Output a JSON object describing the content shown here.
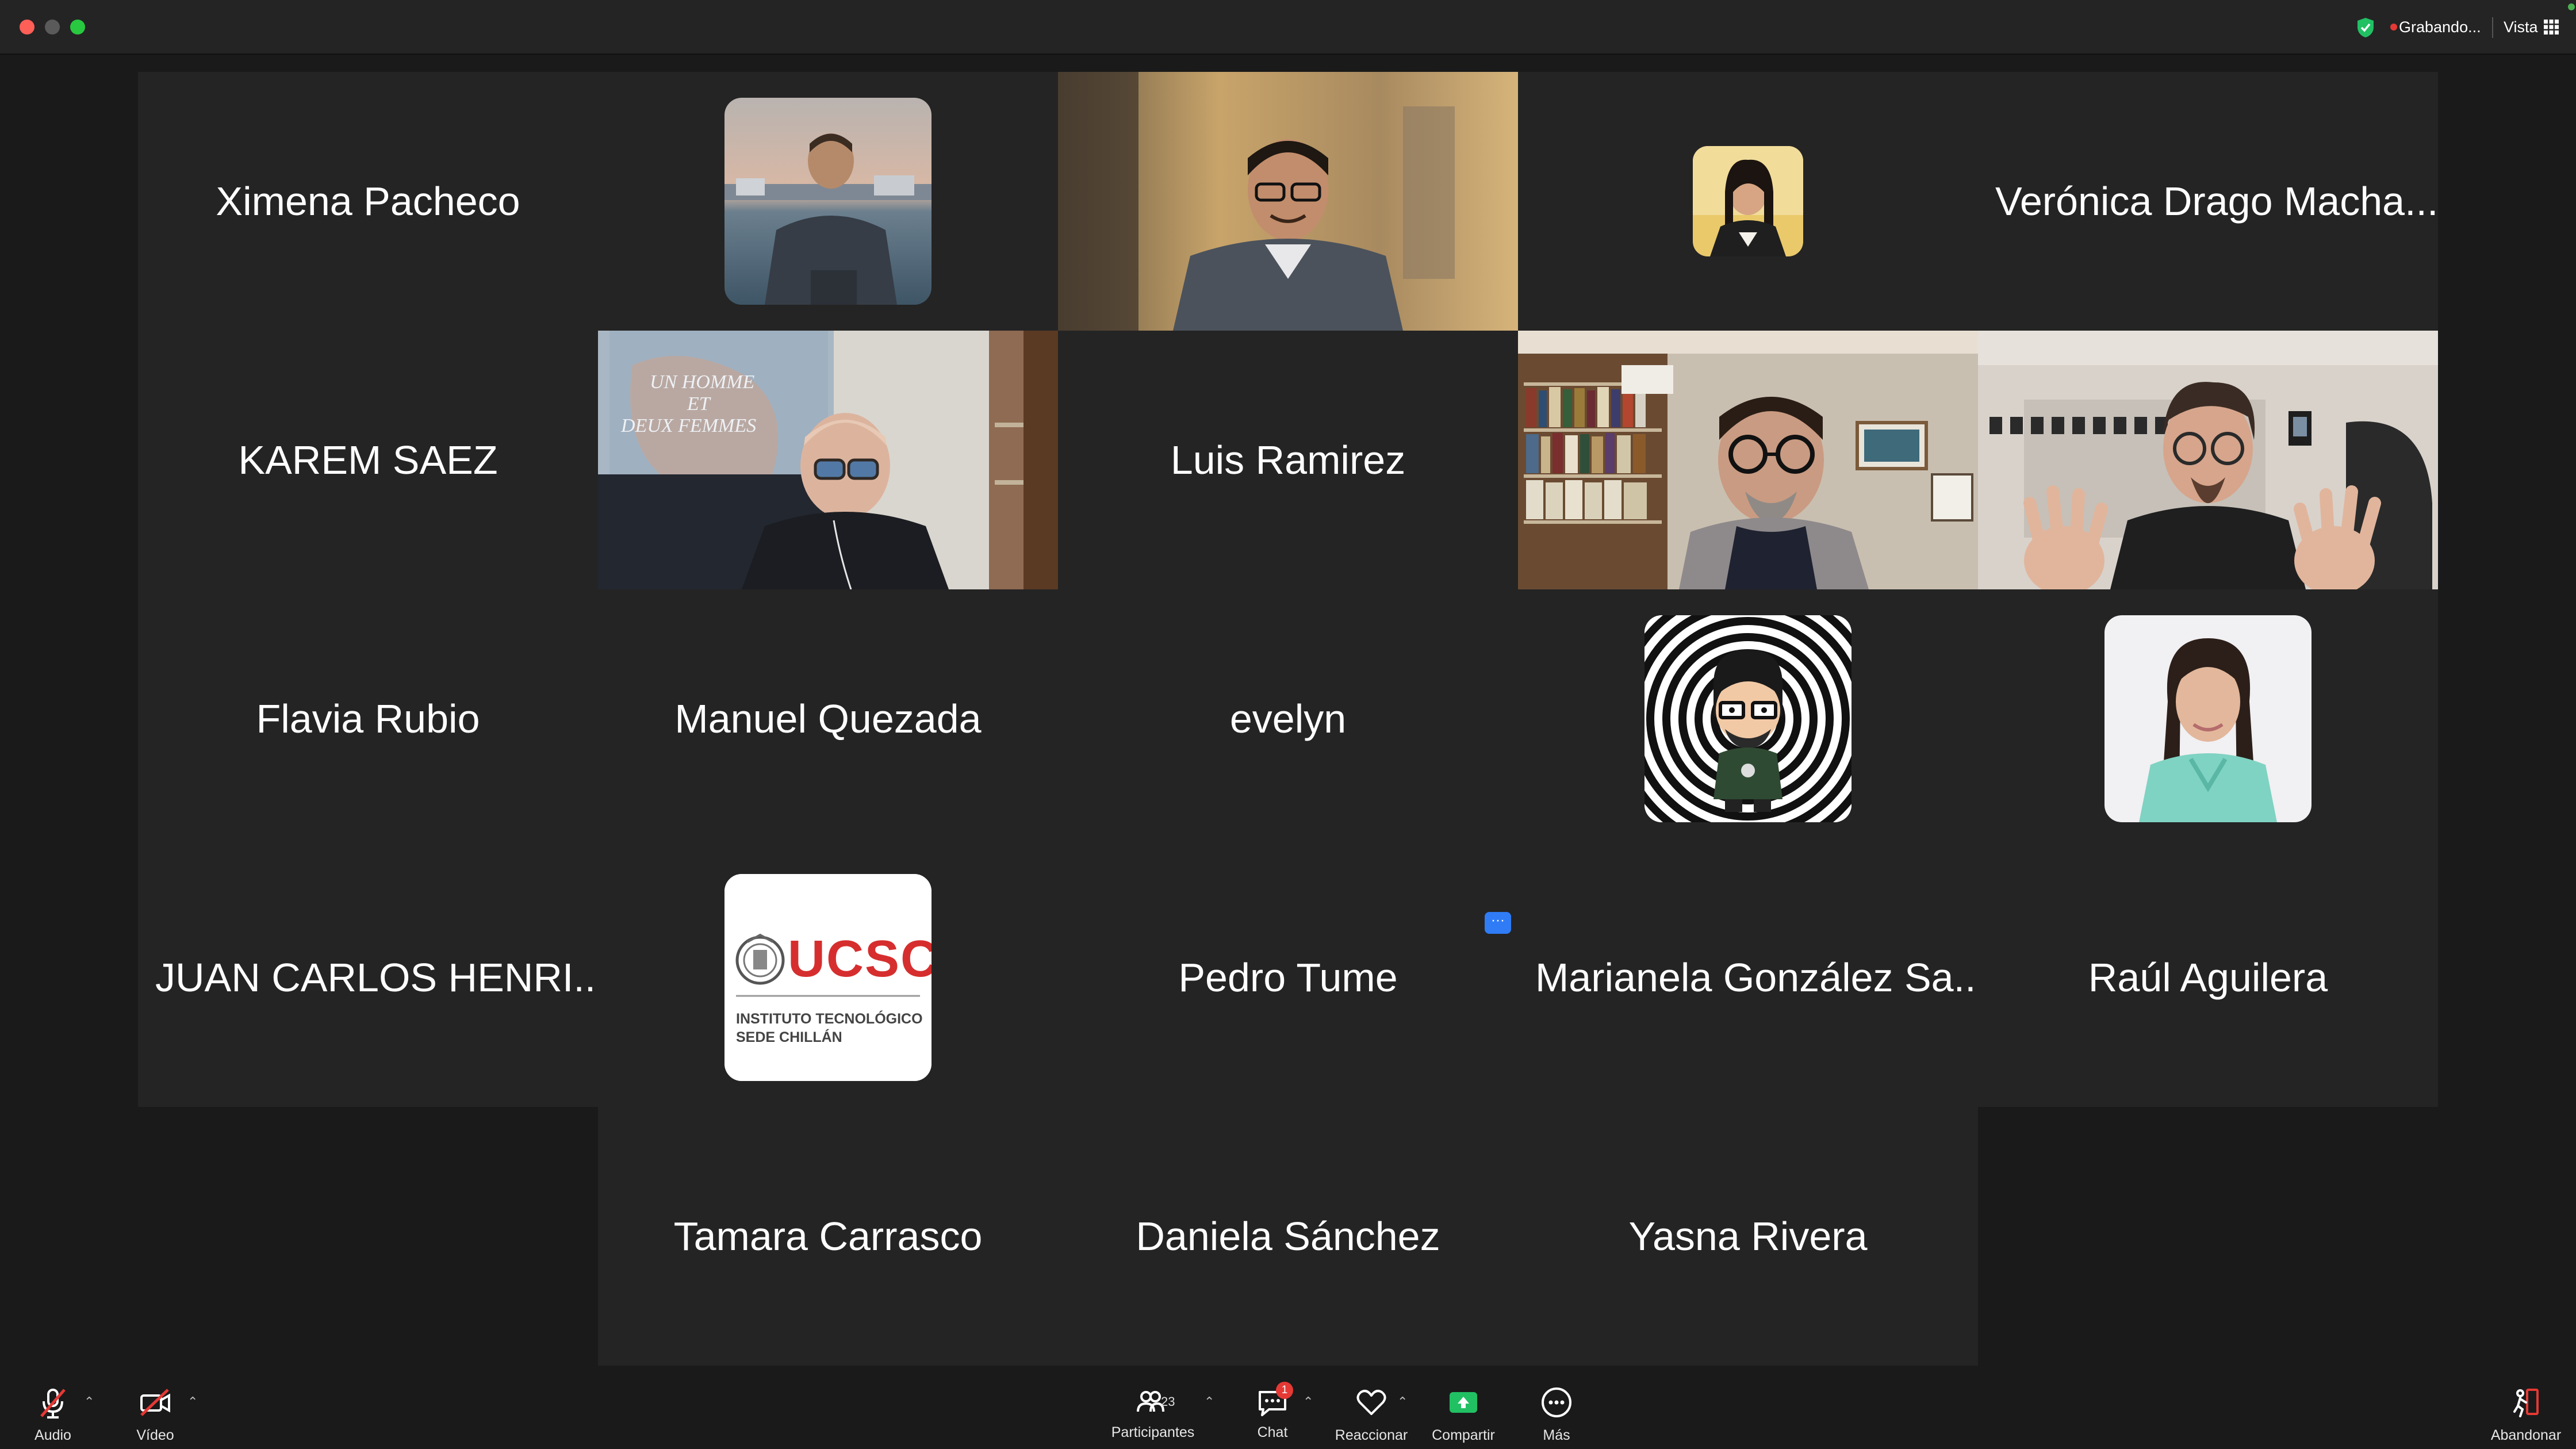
{
  "titlebar": {
    "recording_label": "Grabando...",
    "view_label": "Vista"
  },
  "participants": [
    {
      "name": "Ximena Pacheco"
    },
    {
      "name": "Luis Ramirez"
    },
    {
      "name": "Verónica Drago Macha..."
    },
    {
      "name": "KAREM SAEZ"
    },
    {
      "name": "Flavia Rubio"
    },
    {
      "name": "Manuel Quezada"
    },
    {
      "name": "evelyn"
    },
    {
      "name": "JUAN CARLOS HENRI..."
    },
    {
      "name": "Pedro Tume"
    },
    {
      "name": "Marianela González Sa..."
    },
    {
      "name": "Raúl Aguilera"
    },
    {
      "name": "Tamara Carrasco"
    },
    {
      "name": "Daniela Sánchez"
    },
    {
      "name": "Yasna Rivera"
    }
  ],
  "ucsc_logo": {
    "acronym": "UCSC",
    "line1": "INSTITUTO TECNOLÓGICO",
    "line2": "SEDE CHILLÁN"
  },
  "video_overlay": {
    "poster_line1": "UN HOMME",
    "poster_line2": "ET",
    "poster_line3": "DEUX FEMMES"
  },
  "tile_badge": "···",
  "toolbar": {
    "audio_label": "Audio",
    "video_label": "Vídeo",
    "participants_label": "Participantes",
    "participants_count": "23",
    "chat_label": "Chat",
    "chat_badge": "1",
    "react_label": "Reaccionar",
    "share_label": "Compartir",
    "more_label": "Más",
    "leave_label": "Abandonar"
  },
  "colors": {
    "active_speaker": "#4cd964",
    "share_green": "#21c063",
    "badge_red": "#e53935",
    "tile_bg": "#242424"
  }
}
